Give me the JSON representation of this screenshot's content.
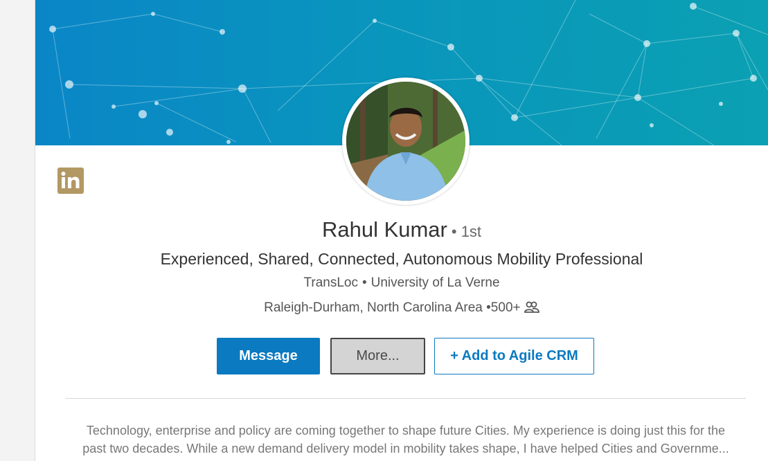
{
  "profile": {
    "name": "Rahul Kumar",
    "degree": "• 1st",
    "headline": "Experienced, Shared, Connected, Autonomous Mobility Professional",
    "company": "TransLoc",
    "school": "University of La Verne",
    "org_separator": "•",
    "location": "Raleigh-Durham, North Carolina Area",
    "connections": "•500+",
    "connections_icon": "people-icon"
  },
  "actions": {
    "message_label": "Message",
    "more_label": "More...",
    "crm_label": "+ Add to Agile CRM"
  },
  "summary": {
    "line1": "Technology, enterprise and policy are coming together to shape future Cities. My experience is doing just this for the",
    "line2": "past two decades. While a new demand delivery model in mobility takes shape, I have helped Cities and Governme..."
  },
  "icons": {
    "linkedin_badge": "linkedin-icon"
  },
  "colors": {
    "accent": "#0b7ac1",
    "badge": "#b29863",
    "banner_start": "#0a86c7",
    "banner_end": "#0ba0b3"
  }
}
